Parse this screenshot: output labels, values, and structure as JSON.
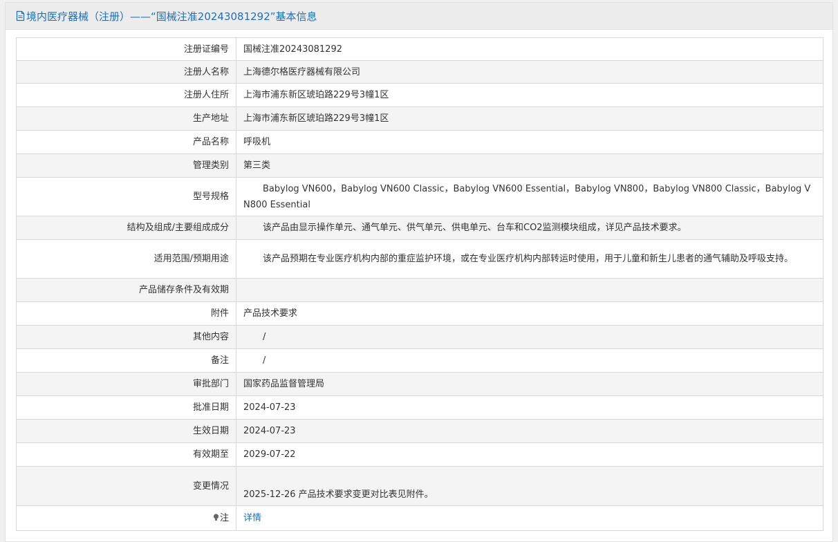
{
  "header": {
    "title": "境内医疗器械（注册）——“国械注准20243081292”基本信息",
    "title_color": "#1f6fb5"
  },
  "rows": [
    {
      "label": "注册证编号",
      "value": "国械注准20243081292"
    },
    {
      "label": "注册人名称",
      "value": "上海德尔格医疗器械有限公司"
    },
    {
      "label": "注册人住所",
      "value": "上海市浦东新区琥珀路229号3幢1区"
    },
    {
      "label": "生产地址",
      "value": "上海市浦东新区琥珀路229号3幢1区"
    },
    {
      "label": "产品名称",
      "value": "呼吸机"
    },
    {
      "label": "管理类别",
      "value": "第三类"
    },
    {
      "label": "型号规格",
      "value": "Babylog VN600，Babylog VN600 Classic，Babylog VN600 Essential，Babylog VN800，Babylog VN800 Classic，Babylog VN800 Essential"
    },
    {
      "label": "结构及组成/主要组成成分",
      "value": "该产品由显示操作单元、通气单元、供气单元、供电单元、台车和CO2监测模块组成，详见产品技术要求。"
    },
    {
      "label": "适用范围/预期用途",
      "value": "该产品预期在专业医疗机构内部的重症监护环境，或在专业医疗机构内部转运时使用，用于儿童和新生儿患者的通气辅助及呼吸支持。"
    },
    {
      "label": "产品储存条件及有效期",
      "value": ""
    },
    {
      "label": "附件",
      "value": "产品技术要求"
    },
    {
      "label": "其他内容",
      "value": "/"
    },
    {
      "label": "备注",
      "value": "/"
    },
    {
      "label": "审批部门",
      "value": "国家药品监督管理局"
    },
    {
      "label": "批准日期",
      "value": "2024-07-23"
    },
    {
      "label": "生效日期",
      "value": "2024-07-23"
    },
    {
      "label": "有效期至",
      "value": "2029-07-22"
    },
    {
      "label": "变更情况",
      "value": "2025-12-26 产品技术要求变更对比表见附件。"
    },
    {
      "label": "注",
      "value": "详情"
    }
  ],
  "icons": {
    "title": "document-icon",
    "note": "lightbulb-icon"
  }
}
